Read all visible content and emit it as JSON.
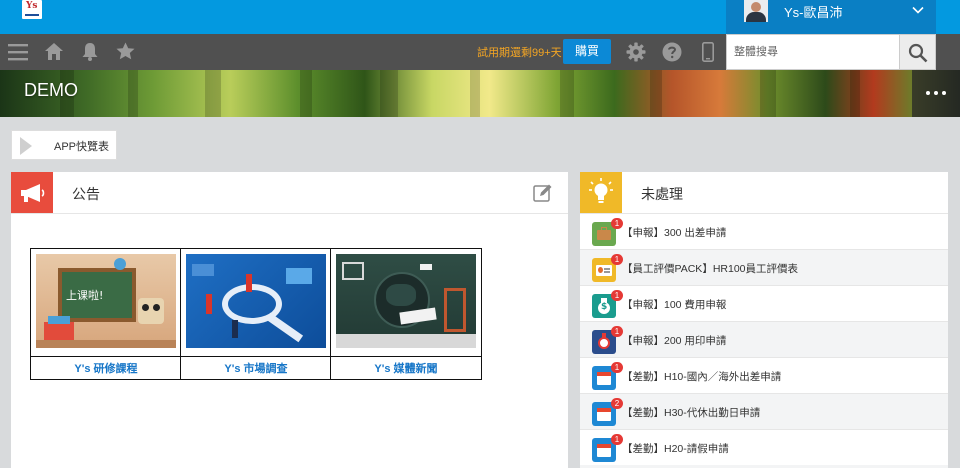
{
  "header": {
    "logo_text": "Ys",
    "user_name": "Ys-歐昌沛"
  },
  "toolbar": {
    "trial_text": "試用期還剩99+天",
    "buy_label": "購買",
    "search_placeholder": "整體搜尋"
  },
  "banner": {
    "title": "DEMO"
  },
  "quick": {
    "app_label": "APP快覽表"
  },
  "announcement": {
    "title": "公告",
    "links": [
      {
        "caption": "Y's 研修課程",
        "image_text": "上课啦!"
      },
      {
        "caption": "Y's 市場調查"
      },
      {
        "caption": "Y's 媒體新聞"
      }
    ]
  },
  "todo": {
    "title": "未處理",
    "items": [
      {
        "label": "【申報】300 出差申請",
        "badge": "1",
        "icon": "briefcase-icon",
        "color": "#6aa84f"
      },
      {
        "label": "【員工評價PACK】HR100員工評價表",
        "badge": "1",
        "icon": "id-card-icon",
        "color": "#f0b928"
      },
      {
        "label": "【申報】100 費用申報",
        "badge": "1",
        "icon": "money-bag-icon",
        "color": "#1a9c8e"
      },
      {
        "label": "【申報】200 用印申請",
        "badge": "1",
        "icon": "stamp-icon",
        "color": "#2b4d8c"
      },
      {
        "label": "【差勤】H10-國內／海外出差申請",
        "badge": "1",
        "icon": "calendar-icon",
        "color": "#1e88d4"
      },
      {
        "label": "【差勤】H30-代休出勤日申請",
        "badge": "2",
        "icon": "calendar-icon",
        "color": "#1e88d4"
      },
      {
        "label": "【差勤】H20-請假申請",
        "badge": "1",
        "icon": "calendar-icon",
        "color": "#1e88d4"
      }
    ]
  }
}
